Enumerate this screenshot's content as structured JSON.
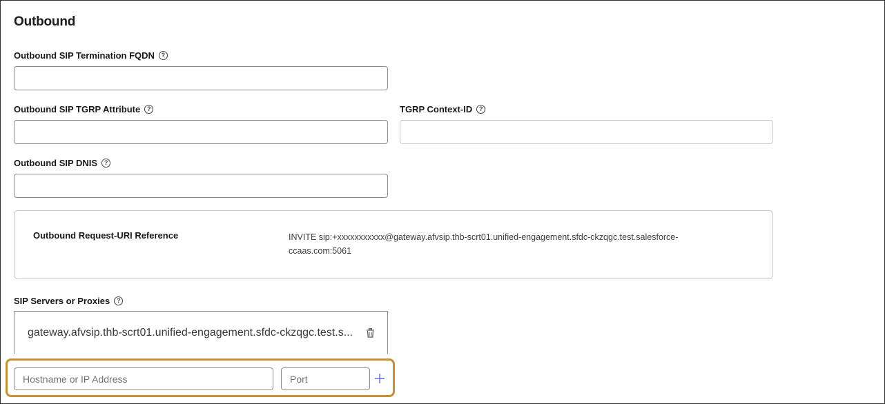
{
  "section": {
    "title": "Outbound"
  },
  "fields": {
    "fqdn": {
      "label": "Outbound SIP Termination FQDN",
      "value": ""
    },
    "tgrp": {
      "label": "Outbound SIP TGRP Attribute",
      "value": ""
    },
    "tgrp_context": {
      "label": "TGRP Context-ID",
      "value": ""
    },
    "dnis": {
      "label": "Outbound SIP DNIS",
      "value": ""
    }
  },
  "help_icon": "question-circle-icon",
  "reference": {
    "label": "Outbound Request-URI Reference",
    "value": "INVITE sip:+xxxxxxxxxxx@gateway.afvsip.thb-scrt01.unified-engagement.sfdc-ckzqgc.test.salesforce-ccaas.com:5061"
  },
  "servers": {
    "label": "SIP Servers or Proxies",
    "entries": [
      "gateway.afvsip.thb-scrt01.unified-engagement.sfdc-ckzqgc.test.s..."
    ],
    "hostname_placeholder": "Hostname or IP Address",
    "port_placeholder": "Port"
  },
  "colors": {
    "highlight": "#c8912f",
    "add_icon": "#5867e8"
  }
}
